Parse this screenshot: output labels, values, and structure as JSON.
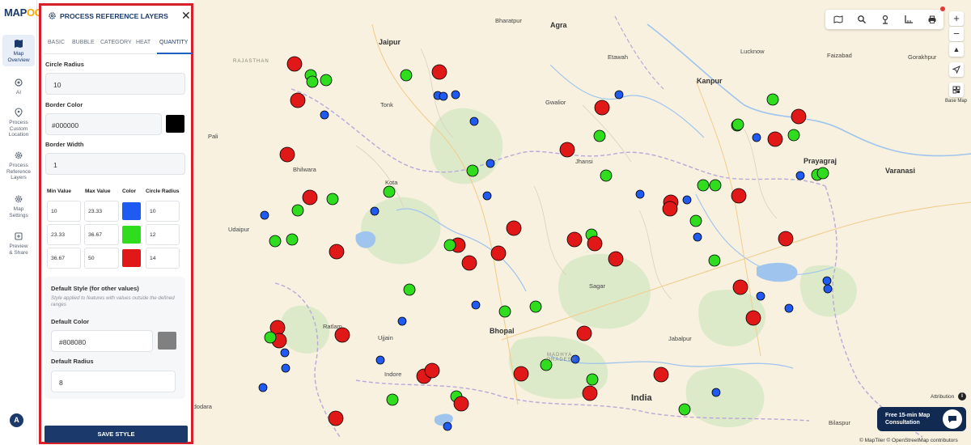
{
  "app": {
    "logo_main": "MAP",
    "logo_accent": "OG"
  },
  "rail": {
    "items": [
      {
        "label": "Map\nOverview",
        "icon": "map-icon"
      },
      {
        "label": "AI",
        "icon": "ai-icon"
      },
      {
        "label": "Process\nCustom\nLocation",
        "icon": "location-pin-icon"
      },
      {
        "label": "Process\nReference\nLayers",
        "icon": "gear-icon"
      },
      {
        "label": "Map\nSettings",
        "icon": "gear-icon"
      },
      {
        "label": "Preview\n& Share",
        "icon": "share-icon"
      }
    ],
    "avatar": "A"
  },
  "panel": {
    "title": "PROCESS REFERENCE LAYERS",
    "close": "✕",
    "tabs": [
      "BASIC",
      "BUBBLE",
      "CATEGORY",
      "HEAT",
      "QUANTITY"
    ],
    "active_tab": "QUANTITY",
    "circle_radius_label": "Circle Radius",
    "circle_radius_value": "10",
    "border_color_label": "Border Color",
    "border_color_value": "#000000",
    "border_width_label": "Border Width",
    "border_width_value": "1",
    "table_headers": [
      "Min Value",
      "Max Value",
      "Color",
      "Circle Radius"
    ],
    "ranges": [
      {
        "min": "10",
        "max": "23.33",
        "color": "#1f5bf2",
        "radius": "10"
      },
      {
        "min": "23.33",
        "max": "36.67",
        "color": "#2fdc1e",
        "radius": "12"
      },
      {
        "min": "36.67",
        "max": "50",
        "color": "#e01818",
        "radius": "14"
      }
    ],
    "default_style_title": "Default Style (for other values)",
    "default_style_desc": "Style applied to features with values outside the defined ranges",
    "default_color_label": "Default Color",
    "default_color_value": "#808080",
    "default_radius_label": "Default Radius",
    "default_radius_value": "8",
    "save_label": "SAVE STYLE"
  },
  "map": {
    "cities": [
      {
        "name": "Jaipur",
        "big": true
      },
      {
        "name": "Bharatpur"
      },
      {
        "name": "Agra",
        "big": true
      },
      {
        "name": "RAJASTHAN",
        "region": true
      },
      {
        "name": "Etawah"
      },
      {
        "name": "Lucknow"
      },
      {
        "name": "Faizabad"
      },
      {
        "name": "Gorakhpur"
      },
      {
        "name": "Tonk"
      },
      {
        "name": "Gwalior"
      },
      {
        "name": "Kanpur",
        "big": true
      },
      {
        "name": "Pali"
      },
      {
        "name": "Bhilwara"
      },
      {
        "name": "Jhansi"
      },
      {
        "name": "Kota"
      },
      {
        "name": "Varanasi",
        "big": true
      },
      {
        "name": "Prayagraj",
        "big": true
      },
      {
        "name": "Udaipur"
      },
      {
        "name": "Sagar"
      },
      {
        "name": "Bhopal",
        "big": true
      },
      {
        "name": "Ratlam"
      },
      {
        "name": "Ujjain"
      },
      {
        "name": "Indore"
      },
      {
        "name": "Jabalpur"
      },
      {
        "name": "MADHYA PRADESH",
        "region": true
      },
      {
        "name": "India",
        "country": true
      },
      {
        "name": "Vadodara"
      },
      {
        "name": "Bilaspur"
      },
      {
        "name": "Kanpur"
      }
    ],
    "attribution": "Attribution",
    "basemap_label": "Base Map",
    "consult_line1": "Free 15-min Map",
    "consult_line2": "Consultation",
    "credit": "© MapTiler © OpenStreetMap contributors",
    "zoom_in": "+",
    "zoom_out": "−",
    "toolbar_icons": [
      "map-layers-icon",
      "search-icon",
      "location-icon",
      "measure-icon",
      "print-icon"
    ]
  }
}
